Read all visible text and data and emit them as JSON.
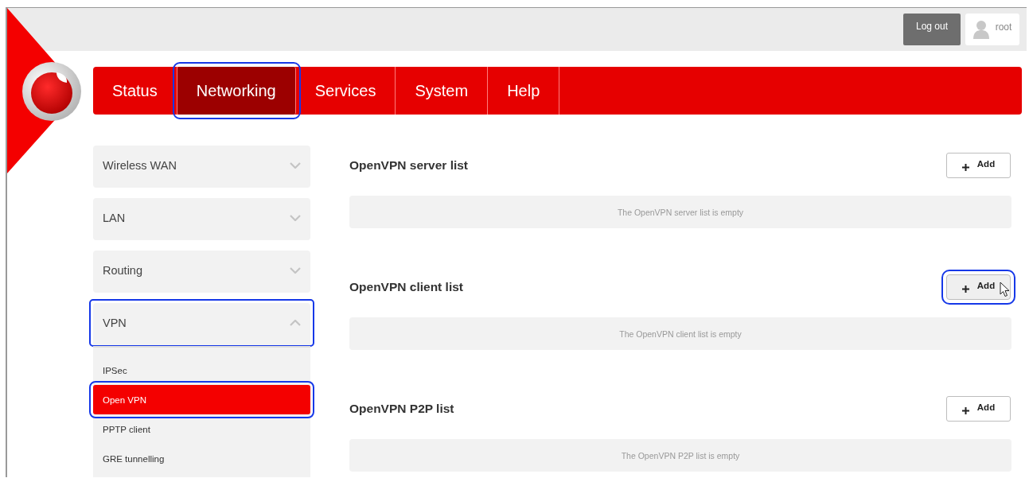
{
  "header": {
    "logout": "Log out",
    "user": "root"
  },
  "nav": [
    {
      "label": "Status",
      "selected": false,
      "highlighted": false
    },
    {
      "label": "Networking",
      "selected": true,
      "highlighted": true
    },
    {
      "label": "Services",
      "selected": false,
      "highlighted": false
    },
    {
      "label": "System",
      "selected": false,
      "highlighted": false
    },
    {
      "label": "Help",
      "selected": false,
      "highlighted": false
    }
  ],
  "sidebar": [
    {
      "label": "Wireless WAN",
      "expanded": false,
      "highlighted": false
    },
    {
      "label": "LAN",
      "expanded": false,
      "highlighted": false
    },
    {
      "label": "Routing",
      "expanded": false,
      "highlighted": false
    },
    {
      "label": "VPN",
      "expanded": true,
      "highlighted": true,
      "children": [
        {
          "label": "IPSec",
          "selected": false,
          "highlighted": false
        },
        {
          "label": "Open VPN",
          "selected": true,
          "highlighted": true
        },
        {
          "label": "PPTP client",
          "selected": false,
          "highlighted": false
        },
        {
          "label": "GRE tunnelling",
          "selected": false,
          "highlighted": false
        }
      ]
    }
  ],
  "sections": [
    {
      "title": "OpenVPN server list",
      "add": "Add",
      "hovered": false,
      "highlighted": false,
      "empty": "The OpenVPN server list is empty"
    },
    {
      "title": "OpenVPN client list",
      "add": "Add",
      "hovered": true,
      "highlighted": true,
      "empty": "The OpenVPN client list is empty"
    },
    {
      "title": "OpenVPN P2P list",
      "add": "Add",
      "hovered": false,
      "highlighted": false,
      "empty": "The OpenVPN P2P list is empty"
    }
  ]
}
